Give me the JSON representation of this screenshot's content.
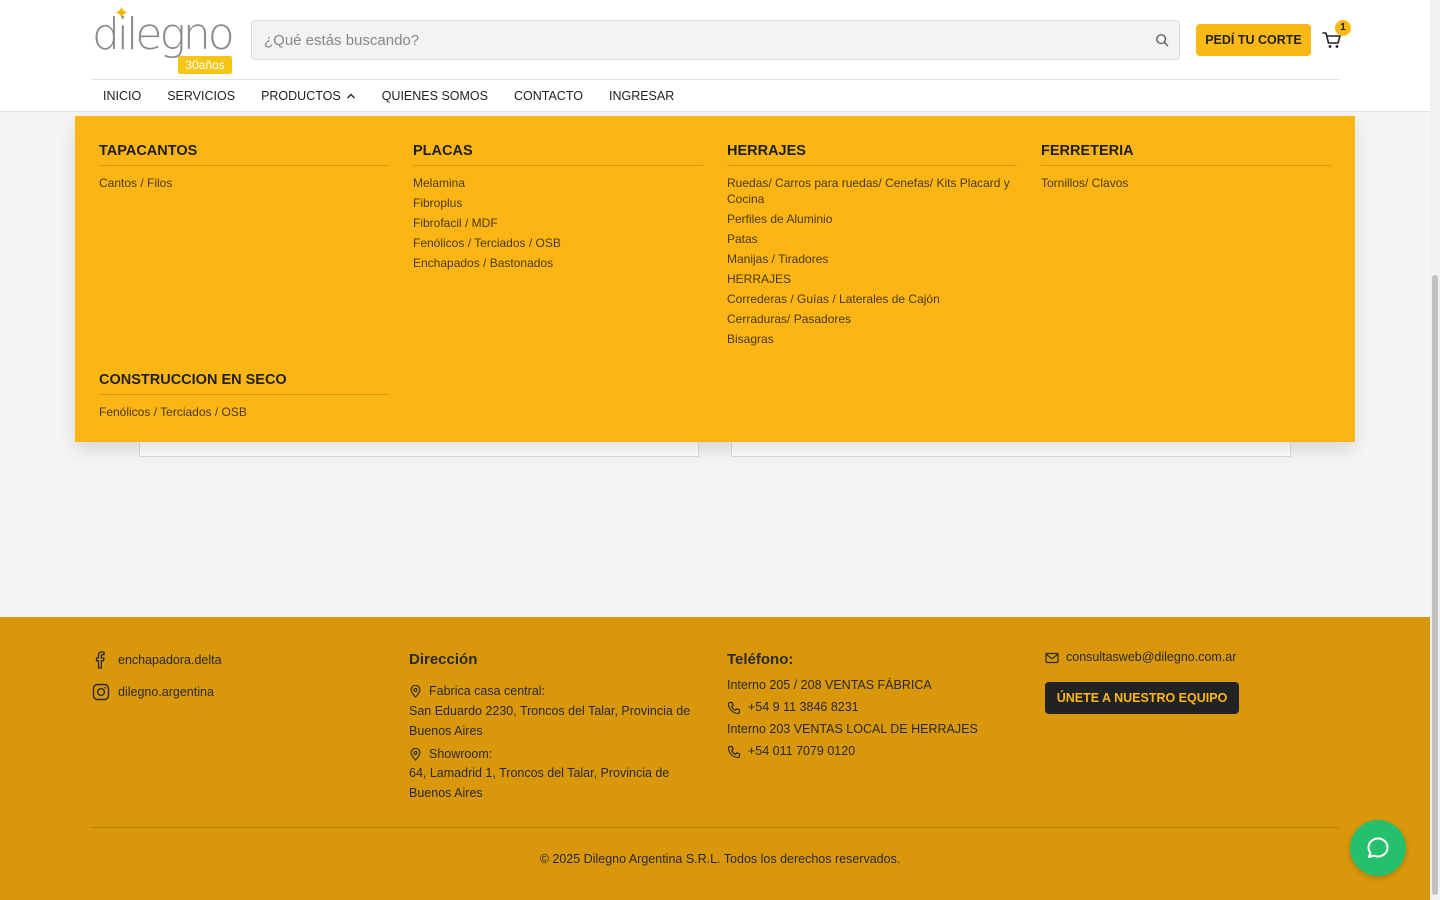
{
  "header": {
    "logo": {
      "brand": "dilegno",
      "badge": "30años"
    },
    "search": {
      "placeholder": "¿Qué estás buscando?"
    },
    "cta_label": "PEDÍ TU CORTE",
    "cart_count": "1",
    "nav": [
      "INICIO",
      "SERVICIOS",
      "PRODUCTOS",
      "QUIENES SOMOS",
      "CONTACTO",
      "INGRESAR"
    ]
  },
  "mega_menu": {
    "columns": [
      {
        "title": "TAPACANTOS",
        "links": [
          "Cantos / Filos"
        ]
      },
      {
        "title": "PLACAS",
        "links": [
          "Melamina",
          "Fibroplus",
          "Fibrofacil / MDF",
          "Fenólicos / Terciados / OSB",
          "Enchapados / Bastonados"
        ]
      },
      {
        "title": "HERRAJES",
        "links": [
          "Ruedas/ Carros para ruedas/ Cenefas/ Kits Placard y Cocina",
          "Perfiles de Aluminio",
          "Patas",
          "Manijas / Tiradores",
          "HERRAJES",
          "Correderas / Guías / Laterales de Cajón",
          "Cerraduras/ Pasadores",
          "Bisagras"
        ]
      },
      {
        "title": "FERRETERIA",
        "links": [
          "Tornillos/ Clavos"
        ]
      },
      {
        "title": "CONSTRUCCION EN SECO",
        "links": [
          "Fenólicos / Terciados / OSB"
        ]
      }
    ]
  },
  "footer": {
    "social": [
      {
        "icon": "facebook-icon",
        "label": "enchapadora.delta"
      },
      {
        "icon": "instagram-icon",
        "label": "dilegno.argentina"
      }
    ],
    "address": {
      "heading": "Dirección",
      "central_label": "Fabrica casa central:",
      "central_address": "San Eduardo 2230, Troncos del Talar, Provincia de Buenos Aires",
      "showroom_label": "Showroom:",
      "showroom_address": "64, Lamadrid 1, Troncos del Talar, Provincia de Buenos Aires"
    },
    "phone": {
      "heading": "Teléfono:",
      "factory_label": "Interno 205 / 208 VENTAS FÁBRICA",
      "factory_number": "+54 9 11 3846 8231",
      "local_label": "Interno 203 VENTAS LOCAL DE HERRAJES",
      "local_number": "+54 011 7079 0120"
    },
    "email": "consultasweb@dilegno.com.ar",
    "team_button": "ÚNETE A NUESTRO EQUIPO",
    "copyright": "© 2025 Dilegno Argentina S.R.L. Todos los derechos reservados."
  },
  "colors": {
    "accent": "#fbb616",
    "footer": "#d9980c",
    "chat": "#25c06b"
  }
}
